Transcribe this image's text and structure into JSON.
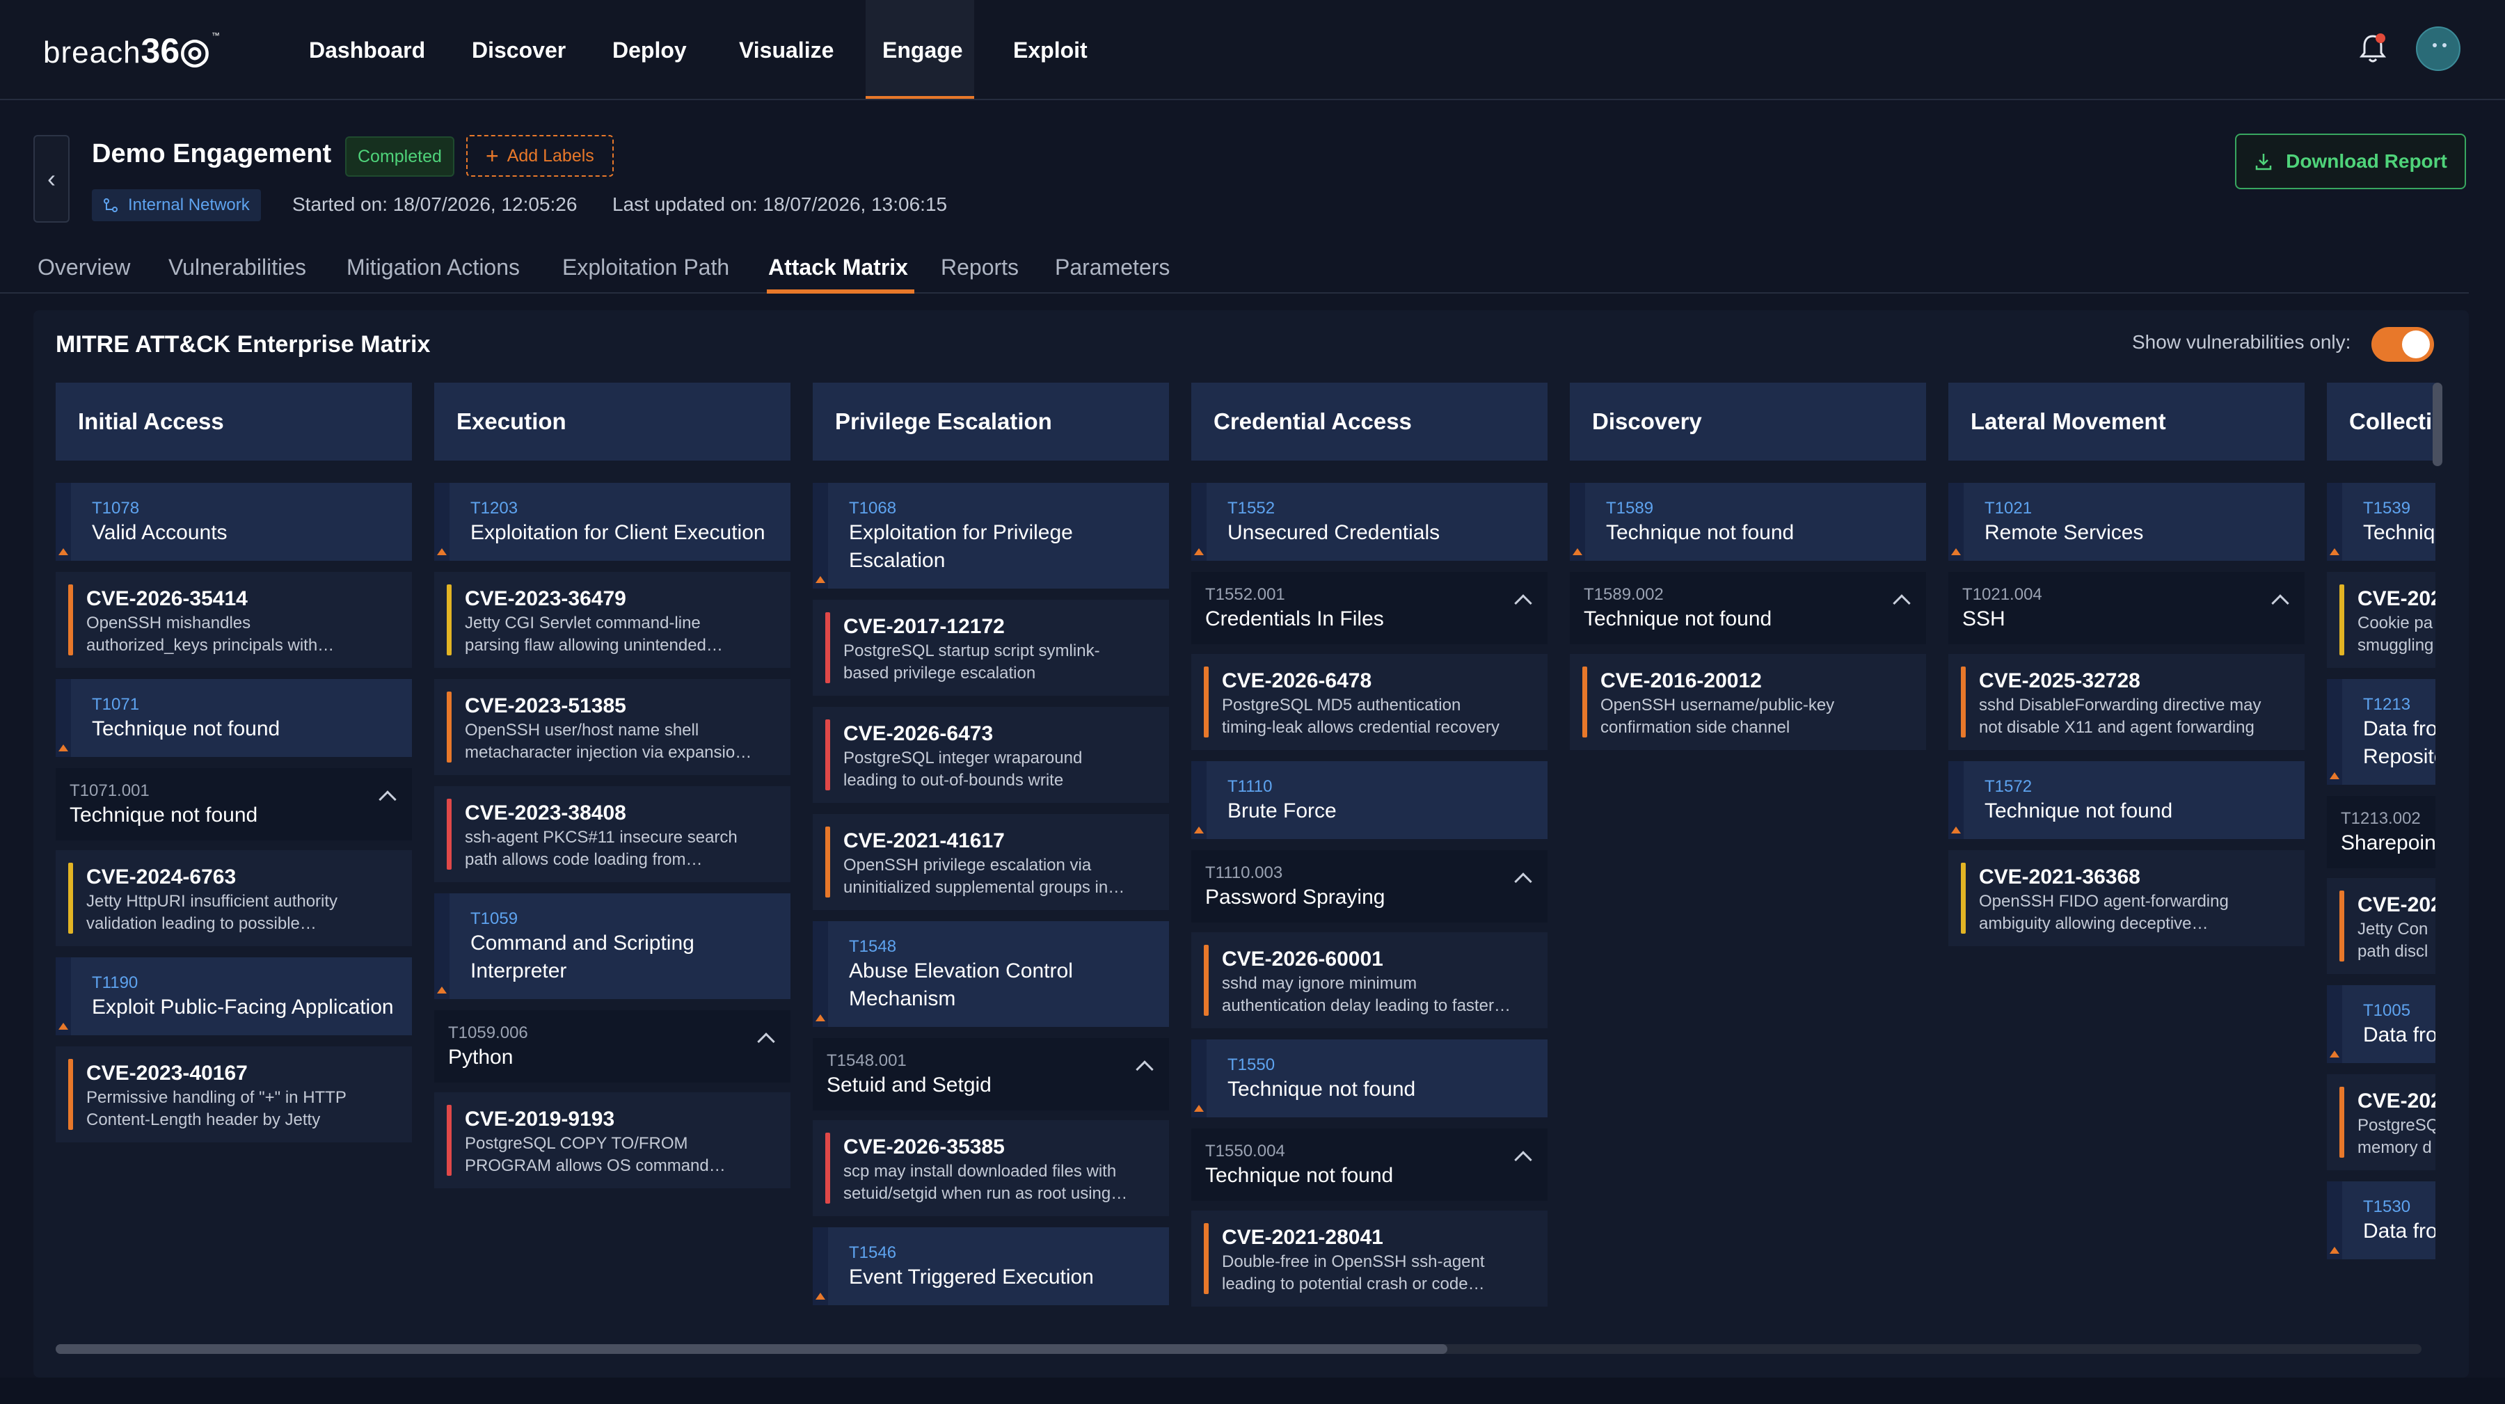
{
  "app": {
    "logo_text": "breach",
    "logo_num": "36",
    "logo_tm": "™",
    "nav": [
      "Dashboard",
      "Discover",
      "Deploy",
      "Visualize",
      "Engage",
      "Exploit"
    ],
    "active_nav": "Engage"
  },
  "header": {
    "back_icon": "‹",
    "title": "Demo Engagement",
    "status": "Completed",
    "add_labels": "Add Labels",
    "network": "Internal Network",
    "started": "Started on: 18/07/2026, 12:05:26",
    "updated": "Last updated on: 18/07/2026, 13:06:15",
    "download": "Download Report"
  },
  "tabs": [
    "Overview",
    "Vulnerabilities",
    "Mitigation Actions",
    "Exploitation Path",
    "Attack Matrix",
    "Reports",
    "Parameters"
  ],
  "active_tab": "Attack Matrix",
  "matrix": {
    "title": "MITRE ATT&CK Enterprise Matrix",
    "toggle_label": "Show vulnerabilities only:",
    "toggle_on": true,
    "severity_colors": {
      "high": "#e8782a",
      "medium": "#e2b424",
      "critical": "#e04848"
    },
    "columns": [
      {
        "name": "Initial Access",
        "items": [
          {
            "kind": "tech",
            "id": "T1078",
            "name": "Valid Accounts"
          },
          {
            "kind": "vuln",
            "cve": "CVE-2026-35414",
            "desc1": "OpenSSH mishandles",
            "desc2": "authorized_keys principals with…",
            "sev": "high"
          },
          {
            "kind": "tech",
            "id": "T1071",
            "name": "Technique not found"
          },
          {
            "kind": "sub",
            "id": "T1071.001",
            "name": "Technique not found"
          },
          {
            "kind": "vuln",
            "cve": "CVE-2024-6763",
            "desc1": "Jetty HttpURI insufficient authority",
            "desc2": "validation leading to possible…",
            "sev": "medium"
          },
          {
            "kind": "tech",
            "id": "T1190",
            "name": "Exploit Public-Facing Application"
          },
          {
            "kind": "vuln",
            "cve": "CVE-2023-40167",
            "desc1": "Permissive handling of \"+\" in HTTP",
            "desc2": "Content-Length header by Jetty",
            "sev": "high"
          }
        ]
      },
      {
        "name": "Execution",
        "items": [
          {
            "kind": "tech",
            "id": "T1203",
            "name": "Exploitation for Client Execution"
          },
          {
            "kind": "vuln",
            "cve": "CVE-2023-36479",
            "desc1": "Jetty CGI Servlet command-line",
            "desc2": "parsing flaw allowing unintended…",
            "sev": "medium"
          },
          {
            "kind": "vuln",
            "cve": "CVE-2023-51385",
            "desc1": "OpenSSH user/host name shell",
            "desc2": "metacharacter injection via expansio…",
            "sev": "high"
          },
          {
            "kind": "vuln",
            "cve": "CVE-2023-38408",
            "desc1": "ssh-agent PKCS#11 insecure search",
            "desc2": "path allows code loading from…",
            "sev": "critical"
          },
          {
            "kind": "tech",
            "id": "T1059",
            "name": "Command and Scripting",
            "name2": "Interpreter"
          },
          {
            "kind": "sub",
            "id": "T1059.006",
            "name": "Python"
          },
          {
            "kind": "vuln",
            "cve": "CVE-2019-9193",
            "desc1": "PostgreSQL COPY TO/FROM",
            "desc2": "PROGRAM allows OS command…",
            "sev": "critical"
          }
        ]
      },
      {
        "name": "Privilege Escalation",
        "items": [
          {
            "kind": "tech",
            "id": "T1068",
            "name": "Exploitation for Privilege",
            "name2": "Escalation"
          },
          {
            "kind": "vuln",
            "cve": "CVE-2017-12172",
            "desc1": "PostgreSQL startup script symlink-",
            "desc2": "based privilege escalation",
            "sev": "critical"
          },
          {
            "kind": "vuln",
            "cve": "CVE-2026-6473",
            "desc1": "PostgreSQL integer wraparound",
            "desc2": "leading to out-of-bounds write",
            "sev": "critical"
          },
          {
            "kind": "vuln",
            "cve": "CVE-2021-41617",
            "desc1": "OpenSSH privilege escalation via",
            "desc2": "uninitialized supplemental groups in…",
            "sev": "high"
          },
          {
            "kind": "tech",
            "id": "T1548",
            "name": "Abuse Elevation Control",
            "name2": "Mechanism"
          },
          {
            "kind": "sub",
            "id": "T1548.001",
            "name": "Setuid and Setgid"
          },
          {
            "kind": "vuln",
            "cve": "CVE-2026-35385",
            "desc1": "scp may install downloaded files with",
            "desc2": "setuid/setgid when run as root using…",
            "sev": "critical"
          },
          {
            "kind": "tech",
            "id": "T1546",
            "name": "Event Triggered Execution"
          }
        ]
      },
      {
        "name": "Credential Access",
        "items": [
          {
            "kind": "tech",
            "id": "T1552",
            "name": "Unsecured Credentials"
          },
          {
            "kind": "sub",
            "id": "T1552.001",
            "name": "Credentials In Files"
          },
          {
            "kind": "vuln",
            "cve": "CVE-2026-6478",
            "desc1": "PostgreSQL MD5 authentication",
            "desc2": "timing-leak allows credential recovery",
            "sev": "high"
          },
          {
            "kind": "tech",
            "id": "T1110",
            "name": "Brute Force"
          },
          {
            "kind": "sub",
            "id": "T1110.003",
            "name": "Password Spraying"
          },
          {
            "kind": "vuln",
            "cve": "CVE-2026-60001",
            "desc1": "sshd may ignore minimum",
            "desc2": "authentication delay leading to faster…",
            "sev": "high"
          },
          {
            "kind": "tech",
            "id": "T1550",
            "name": "Technique not found"
          },
          {
            "kind": "sub",
            "id": "T1550.004",
            "name": "Technique not found"
          },
          {
            "kind": "vuln",
            "cve": "CVE-2021-28041",
            "desc1": "Double-free in OpenSSH ssh-agent",
            "desc2": "leading to potential crash or code…",
            "sev": "high"
          }
        ]
      },
      {
        "name": "Discovery",
        "items": [
          {
            "kind": "tech",
            "id": "T1589",
            "name": "Technique not found"
          },
          {
            "kind": "sub",
            "id": "T1589.002",
            "name": "Technique not found"
          },
          {
            "kind": "vuln",
            "cve": "CVE-2016-20012",
            "desc1": "OpenSSH username/public-key",
            "desc2": "confirmation side channel",
            "sev": "high"
          }
        ]
      },
      {
        "name": "Lateral Movement",
        "items": [
          {
            "kind": "tech",
            "id": "T1021",
            "name": "Remote Services"
          },
          {
            "kind": "sub",
            "id": "T1021.004",
            "name": "SSH"
          },
          {
            "kind": "vuln",
            "cve": "CVE-2025-32728",
            "desc1": "sshd DisableForwarding directive may",
            "desc2": "not disable X11 and agent forwarding",
            "sev": "high"
          },
          {
            "kind": "tech",
            "id": "T1572",
            "name": "Technique not found"
          },
          {
            "kind": "vuln",
            "cve": "CVE-2021-36368",
            "desc1": "OpenSSH FIDO agent-forwarding",
            "desc2": "ambiguity allowing deceptive…",
            "sev": "medium"
          }
        ]
      },
      {
        "name": "Collection",
        "items": [
          {
            "kind": "tech",
            "id": "T1539",
            "name": "Techniq"
          },
          {
            "kind": "vuln",
            "cve": "CVE-202",
            "desc1": "Cookie pa",
            "desc2": "smuggling",
            "sev": "medium"
          },
          {
            "kind": "tech",
            "id": "T1213",
            "name": "Data fro",
            "name2": "Reposito"
          },
          {
            "kind": "sub",
            "id": "T1213.002",
            "name": "Sharepoin"
          },
          {
            "kind": "vuln",
            "cve": "CVE-202",
            "desc1": "Jetty Con",
            "desc2": "path discl",
            "sev": "high"
          },
          {
            "kind": "tech",
            "id": "T1005",
            "name": "Data fro"
          },
          {
            "kind": "vuln",
            "cve": "CVE-202",
            "desc1": "PostgreSQ",
            "desc2": "memory d",
            "sev": "high"
          },
          {
            "kind": "tech",
            "id": "T1530",
            "name": "Data fro"
          }
        ]
      }
    ]
  }
}
